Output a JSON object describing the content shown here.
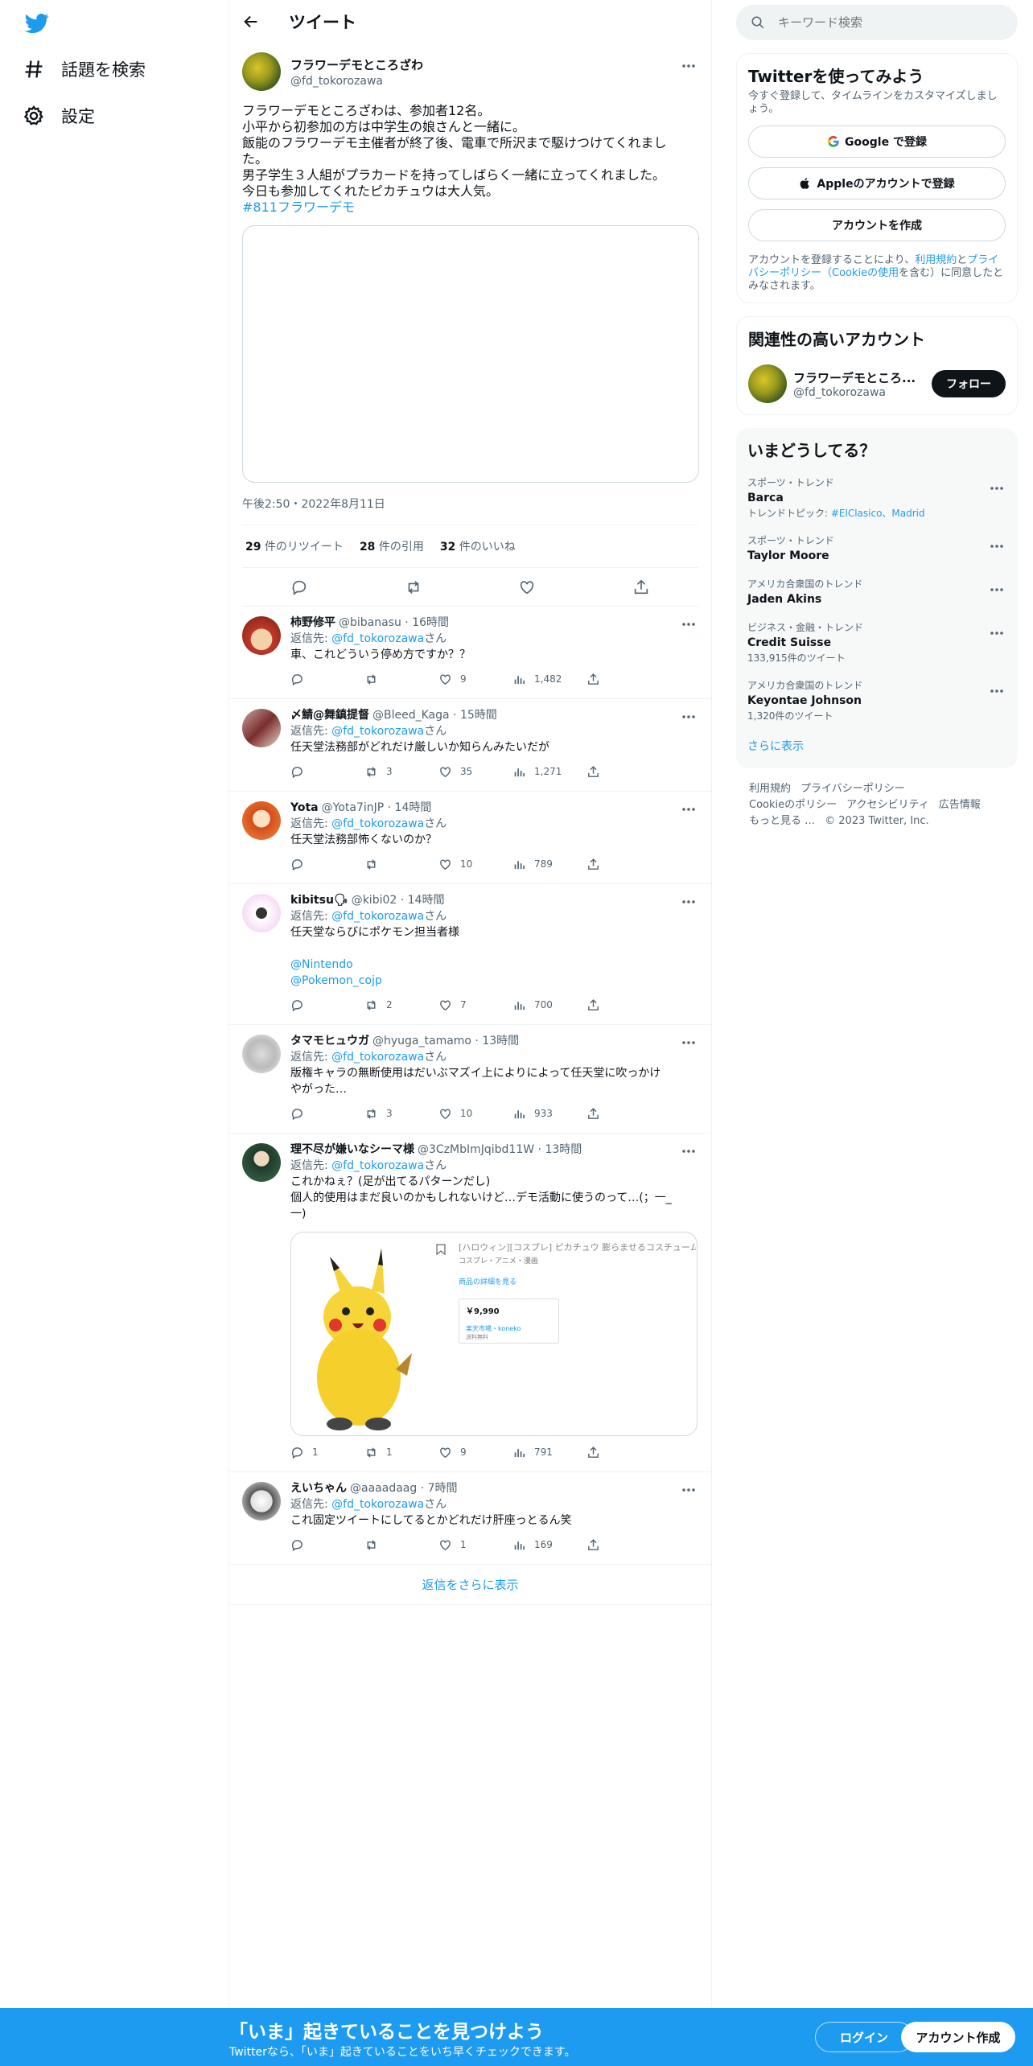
{
  "nav": {
    "explore": "話題を検索",
    "settings": "設定"
  },
  "header": {
    "title": "ツイート"
  },
  "main_tweet": {
    "name": "フラワーデモところざわ",
    "handle": "@fd_tokorozawa",
    "text": "フラワーデモところざわは、参加者12名。\n小平から初参加の方は中学生の娘さんと一緒に。\n飯能のフラワーデモ主催者が終了後、電車で所沢まで駆けつけてくれまし\nた。\n男子学生３人組がプラカードを持ってしばらく一緒に立ってくれました。\n今日も参加してくれたピカチュウは大人気。",
    "hashtag": "#811フラワーデモ",
    "timestamp": "午後2:50・2022年8月11日",
    "retweets_count": "29",
    "retweets_label": " 件のリツイート",
    "quotes_count": "28",
    "quotes_label": " 件の引用",
    "likes_count": "32",
    "likes_label": " 件のいいね"
  },
  "reply_to_prefix": "返信先: ",
  "reply_to_handle": "@fd_tokorozawa",
  "reply_to_suffix": "さん",
  "replies": [
    {
      "name": "柿野修平",
      "meta": "@bibanasu · 16時間",
      "text": "車、これどういう停め方ですか？？",
      "replies": "",
      "retweets": "",
      "likes": "9",
      "views": "1,482"
    },
    {
      "name": "〆鯖@舞鎮提督",
      "meta": "@Bleed_Kaga · 15時間",
      "text": "任天堂法務部がどれだけ厳しいか知らんみたいだが",
      "replies": "",
      "retweets": "3",
      "likes": "35",
      "views": "1,271"
    },
    {
      "name": "Yota",
      "meta": "@Yota7inJP · 14時間",
      "text": "任天堂法務部怖くないのか？",
      "replies": "",
      "retweets": "",
      "likes": "10",
      "views": "789"
    },
    {
      "name": "kibitsu🗣",
      "meta": "@kibi02 · 14時間",
      "text": "任天堂ならびにポケモン担当者様",
      "link1": "@Nintendo",
      "link2": "@Pokemon_cojp",
      "replies": "",
      "retweets": "2",
      "likes": "7",
      "views": "700"
    },
    {
      "name": "タマモヒュウガ",
      "meta": "@hyuga_tamamo · 13時間",
      "text": "版権キャラの無断使用はだいぶマズイ上によりによって任天堂に吹っかけ\nやがった…",
      "replies": "",
      "retweets": "3",
      "likes": "10",
      "views": "933"
    },
    {
      "name": "理不尽が嫌いなシーマ様",
      "meta": "@3CzMbImJqibd11W · 13時間",
      "text": "これかねぇ？(足が出てるパターンだし)\n個人的使用はまだ良いのかもしれないけど…デモ活動に使うのって…(；一_\n一)",
      "replies": "1",
      "retweets": "1",
      "likes": "9",
      "views": "791"
    },
    {
      "name": "えいちゃん",
      "meta": "@aaaadaag · 7時間",
      "text": "これ固定ツイートにしてるとかどれだけ肝座っとるん笑",
      "replies": "",
      "retweets": "",
      "likes": "1",
      "views": "169"
    }
  ],
  "card": {
    "title": "[ハロウィン][コスプレ] ピカチュウ 膨らませるコスチューム コス",
    "sub": "コスプレ・アニメ・漫画",
    "detail": "商品の詳細を見る",
    "price": "￥9,990",
    "shop": "楽天市場・koneko",
    "shipping": "送料無料"
  },
  "show_more_replies": "返信をさらに表示",
  "search": {
    "placeholder": "キーワード検索"
  },
  "signup_panel": {
    "title": "Twitterを使ってみよう",
    "sub": "今すぐ登録して、タイムラインをカスタマイズしましょう。",
    "google": "Google で登録",
    "apple": "Appleのアカウントで登録",
    "create": "アカウントを作成",
    "terms_pre": "アカウントを登録することにより、",
    "terms_link1": "利用規約",
    "terms_mid": "と",
    "terms_link2": "プライバシーポリシー（Cookieの使用",
    "terms_post": "を含む）に同意したとみなされます。"
  },
  "relevant": {
    "title": "関連性の高いアカウント",
    "name": "フラワーデモところ...",
    "handle": "@fd_tokorozawa",
    "follow": "フォロー"
  },
  "trends": {
    "title": "いまどうしてる？",
    "items": [
      {
        "cat": "スポーツ・トレンド",
        "name": "Barca",
        "extra_pre": "トレンドトピック: ",
        "extra_link": "#ElClasico、Madrid"
      },
      {
        "cat": "スポーツ・トレンド",
        "name": "Taylor Moore"
      },
      {
        "cat": "アメリカ合衆国のトレンド",
        "name": "Jaden Akins"
      },
      {
        "cat": "ビジネス・金融・トレンド",
        "name": "Credit Suisse",
        "extra": "133,915件のツイート"
      },
      {
        "cat": "アメリカ合衆国のトレンド",
        "name": "Keyontae Johnson",
        "extra": "1,320件のツイート"
      }
    ],
    "show_more": "さらに表示"
  },
  "footer": {
    "l1": "利用規約",
    "l2": "プライバシーポリシー",
    "l3": "Cookieのポリシー",
    "l4": "アクセシビリティ",
    "l5": "広告情報",
    "l6": "もっと見る …",
    "copy": "© 2023 Twitter, Inc."
  },
  "banner": {
    "title": "「いま」起きていることを見つけよう",
    "sub": "Twitterなら、「いま」起きていることをいち早くチェックできます。",
    "login": "ログイン",
    "signup": "アカウント作成"
  },
  "colors": {
    "accent": "#1d9bf0",
    "text": "#0f1419",
    "secondary": "#536471",
    "border": "#eff3f4"
  }
}
